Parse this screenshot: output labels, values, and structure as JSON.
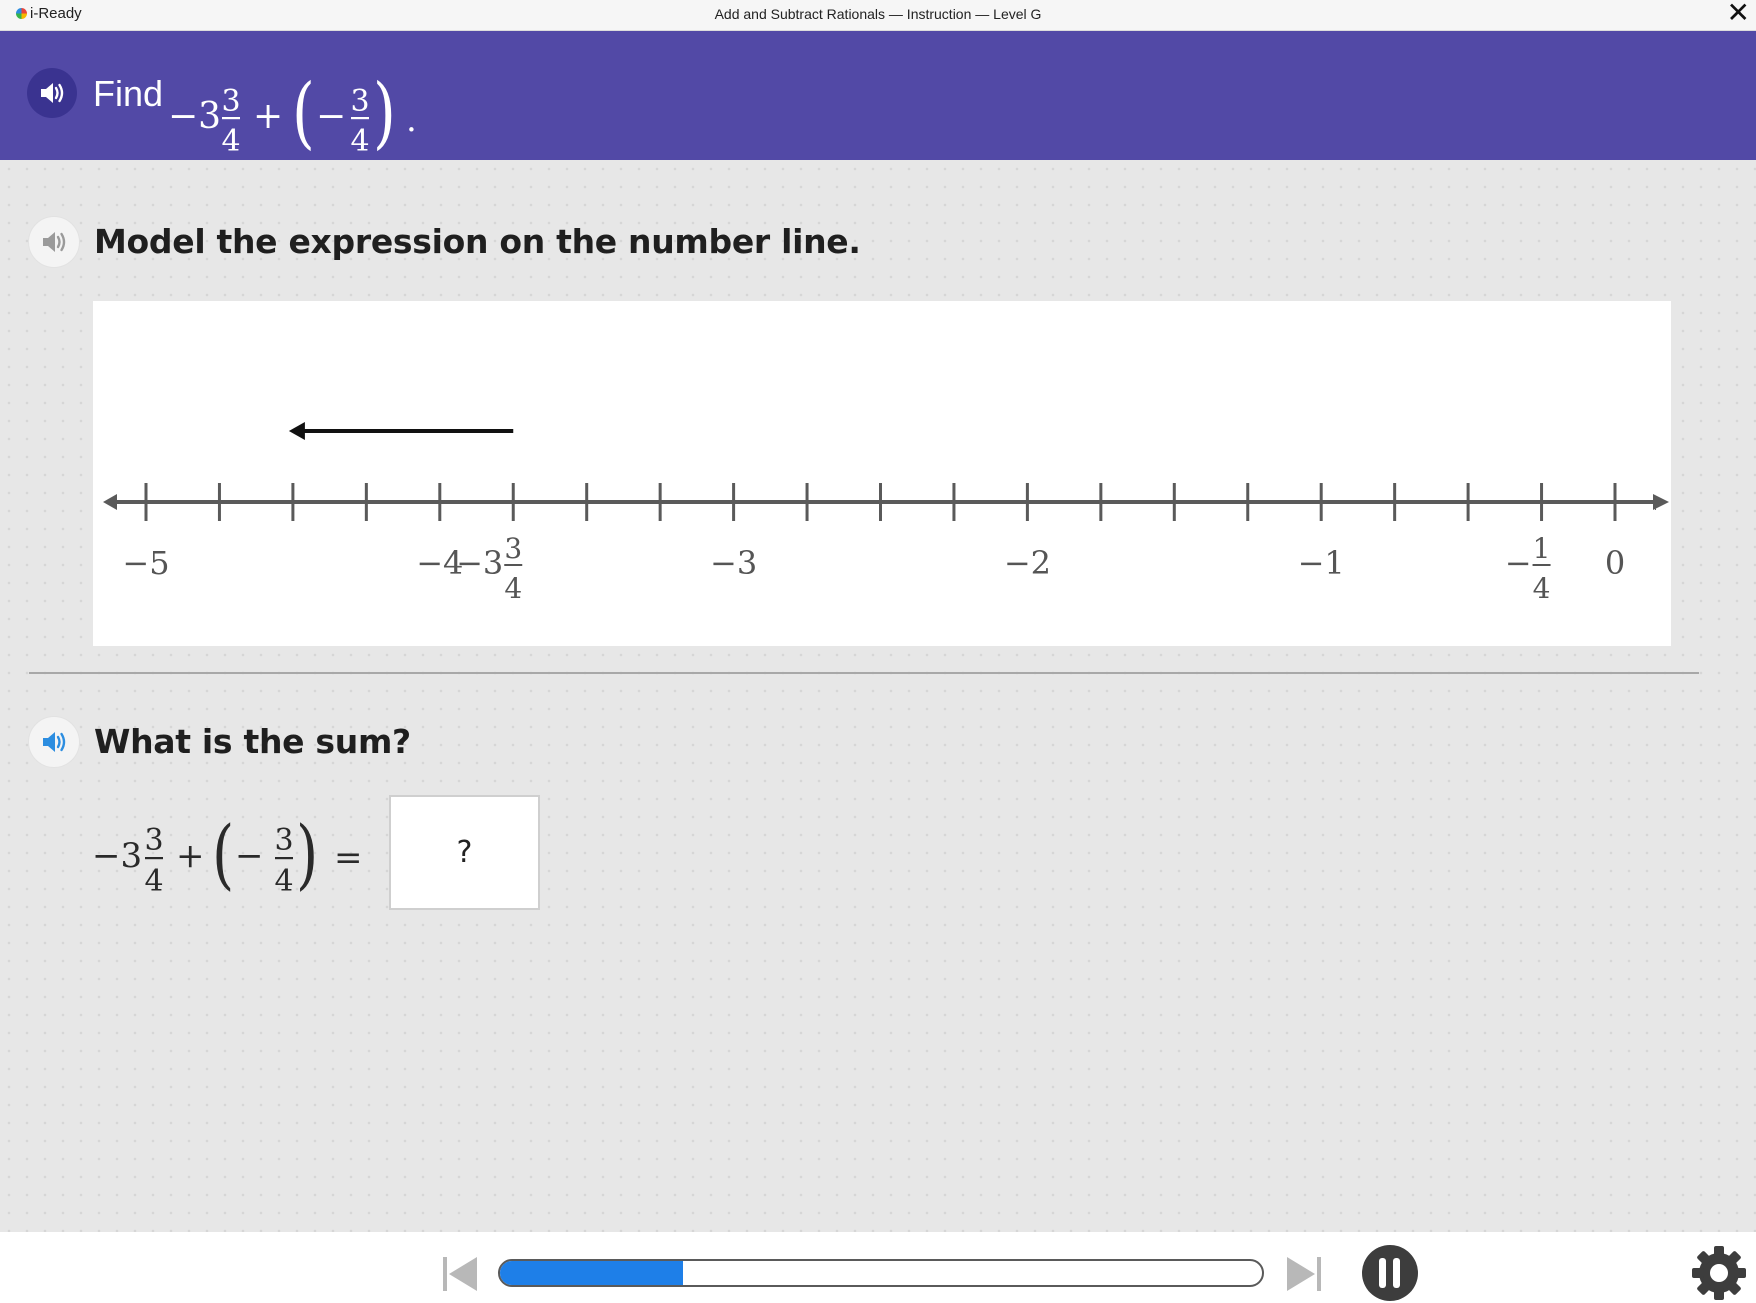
{
  "window": {
    "app_name": "i-Ready",
    "title": "Add and Subtract Rationals — Instruction — Level G",
    "close_glyph": "✕"
  },
  "header": {
    "prompt_prefix": "Find",
    "expression": {
      "whole_neg": "−3",
      "frac1_num": "3",
      "frac1_den": "4",
      "plus": "+",
      "open_paren": "(",
      "neg": "−",
      "frac2_num": "3",
      "frac2_den": "4",
      "close_paren": ")",
      "period": "."
    },
    "speaker_icon": "speaker-icon"
  },
  "question1": {
    "text": "Model the expression on the number line."
  },
  "number_line": {
    "min": -5,
    "max": 0,
    "tick_step": 0.25,
    "labels": [
      {
        "value": -5,
        "text": "−5"
      },
      {
        "value": -4,
        "text": "−4"
      },
      {
        "value": -3,
        "text": "−3"
      },
      {
        "value": -2,
        "text": "−2"
      },
      {
        "value": -1,
        "text": "−1"
      },
      {
        "value": 0,
        "text": "0"
      }
    ],
    "fraction_labels": [
      {
        "value": -3.75,
        "whole": "−3",
        "num": "3",
        "den": "4"
      },
      {
        "value": -0.25,
        "whole": "−",
        "num": "1",
        "den": "4"
      }
    ],
    "arrow": {
      "from": -3.75,
      "to": -4.5,
      "direction": "left"
    }
  },
  "question2": {
    "text": "What is the sum?",
    "expression": {
      "whole_neg": "−3",
      "frac1_num": "3",
      "frac1_den": "4",
      "plus": "+",
      "open_paren": "(",
      "neg": "−",
      "frac2_num": "3",
      "frac2_den": "4",
      "close_paren": ")",
      "equals": "="
    },
    "answer_placeholder": "?"
  },
  "controls": {
    "progress": 0.24,
    "progress_color": "#1e7fe8",
    "header_color": "#5249a6"
  }
}
